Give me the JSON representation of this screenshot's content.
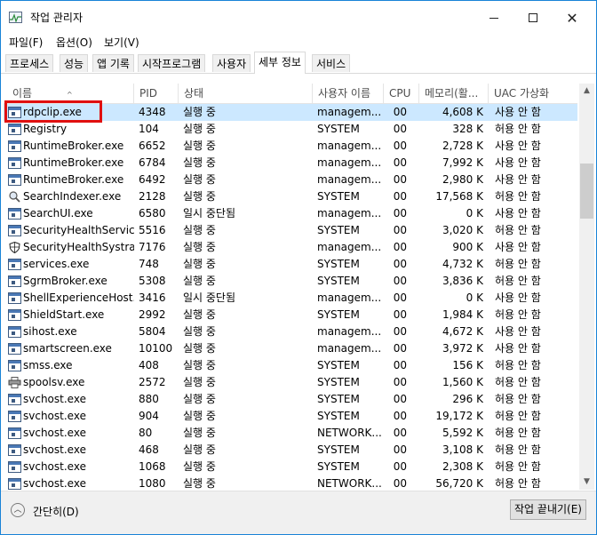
{
  "window": {
    "title": "작업 관리자"
  },
  "menu": [
    "파일(F)",
    "옵션(O)",
    "보기(V)"
  ],
  "tabs": [
    "프로세스",
    "성능",
    "앱 기록",
    "시작프로그램",
    "사용자",
    "세부 정보",
    "서비스"
  ],
  "active_tab": "세부 정보",
  "columns": {
    "name": "이름",
    "pid": "PID",
    "status": "상태",
    "user": "사용자 이름",
    "cpu": "CPU",
    "memory": "메모리(활...",
    "uac": "UAC 가상화"
  },
  "rows": [
    {
      "name": "rdpclip.exe",
      "pid": "4348",
      "status": "실행 중",
      "user": "managem...",
      "cpu": "00",
      "mem": "4,608 K",
      "uac": "사용 안 함",
      "icon": "exe-icon"
    },
    {
      "name": "Registry",
      "pid": "104",
      "status": "실행 중",
      "user": "SYSTEM",
      "cpu": "00",
      "mem": "328 K",
      "uac": "허용 안 함",
      "icon": "exe-icon"
    },
    {
      "name": "RuntimeBroker.exe",
      "pid": "6652",
      "status": "실행 중",
      "user": "managem...",
      "cpu": "00",
      "mem": "2,728 K",
      "uac": "사용 안 함",
      "icon": "exe-icon"
    },
    {
      "name": "RuntimeBroker.exe",
      "pid": "6784",
      "status": "실행 중",
      "user": "managem...",
      "cpu": "00",
      "mem": "7,992 K",
      "uac": "사용 안 함",
      "icon": "exe-icon"
    },
    {
      "name": "RuntimeBroker.exe",
      "pid": "6492",
      "status": "실행 중",
      "user": "managem...",
      "cpu": "00",
      "mem": "2,980 K",
      "uac": "사용 안 함",
      "icon": "exe-icon"
    },
    {
      "name": "SearchIndexer.exe",
      "pid": "2128",
      "status": "실행 중",
      "user": "SYSTEM",
      "cpu": "00",
      "mem": "17,568 K",
      "uac": "허용 안 함",
      "icon": "search-indexer-icon"
    },
    {
      "name": "SearchUI.exe",
      "pid": "6580",
      "status": "일시 중단됨",
      "user": "managem...",
      "cpu": "00",
      "mem": "0 K",
      "uac": "사용 안 함",
      "icon": "exe-icon"
    },
    {
      "name": "SecurityHealthServic...",
      "pid": "5516",
      "status": "실행 중",
      "user": "SYSTEM",
      "cpu": "00",
      "mem": "3,020 K",
      "uac": "허용 안 함",
      "icon": "exe-icon"
    },
    {
      "name": "SecurityHealthSystra...",
      "pid": "7176",
      "status": "실행 중",
      "user": "managem...",
      "cpu": "00",
      "mem": "900 K",
      "uac": "사용 안 함",
      "icon": "shield-icon"
    },
    {
      "name": "services.exe",
      "pid": "748",
      "status": "실행 중",
      "user": "SYSTEM",
      "cpu": "00",
      "mem": "4,732 K",
      "uac": "허용 안 함",
      "icon": "exe-icon"
    },
    {
      "name": "SgrmBroker.exe",
      "pid": "5308",
      "status": "실행 중",
      "user": "SYSTEM",
      "cpu": "00",
      "mem": "3,836 K",
      "uac": "허용 안 함",
      "icon": "exe-icon"
    },
    {
      "name": "ShellExperienceHost...",
      "pid": "3416",
      "status": "일시 중단됨",
      "user": "managem...",
      "cpu": "00",
      "mem": "0 K",
      "uac": "사용 안 함",
      "icon": "exe-icon"
    },
    {
      "name": "ShieldStart.exe",
      "pid": "2992",
      "status": "실행 중",
      "user": "SYSTEM",
      "cpu": "00",
      "mem": "1,984 K",
      "uac": "허용 안 함",
      "icon": "exe-icon"
    },
    {
      "name": "sihost.exe",
      "pid": "5804",
      "status": "실행 중",
      "user": "managem...",
      "cpu": "00",
      "mem": "4,672 K",
      "uac": "사용 안 함",
      "icon": "exe-icon"
    },
    {
      "name": "smartscreen.exe",
      "pid": "10100",
      "status": "실행 중",
      "user": "managem...",
      "cpu": "00",
      "mem": "3,972 K",
      "uac": "사용 안 함",
      "icon": "exe-icon"
    },
    {
      "name": "smss.exe",
      "pid": "408",
      "status": "실행 중",
      "user": "SYSTEM",
      "cpu": "00",
      "mem": "156 K",
      "uac": "허용 안 함",
      "icon": "exe-icon"
    },
    {
      "name": "spoolsv.exe",
      "pid": "2572",
      "status": "실행 중",
      "user": "SYSTEM",
      "cpu": "00",
      "mem": "1,560 K",
      "uac": "허용 안 함",
      "icon": "printer-icon"
    },
    {
      "name": "svchost.exe",
      "pid": "880",
      "status": "실행 중",
      "user": "SYSTEM",
      "cpu": "00",
      "mem": "296 K",
      "uac": "허용 안 함",
      "icon": "exe-icon"
    },
    {
      "name": "svchost.exe",
      "pid": "904",
      "status": "실행 중",
      "user": "SYSTEM",
      "cpu": "00",
      "mem": "19,172 K",
      "uac": "허용 안 함",
      "icon": "exe-icon"
    },
    {
      "name": "svchost.exe",
      "pid": "80",
      "status": "실행 중",
      "user": "NETWORK...",
      "cpu": "00",
      "mem": "5,592 K",
      "uac": "허용 안 함",
      "icon": "exe-icon"
    },
    {
      "name": "svchost.exe",
      "pid": "468",
      "status": "실행 중",
      "user": "SYSTEM",
      "cpu": "00",
      "mem": "3,108 K",
      "uac": "허용 안 함",
      "icon": "exe-icon"
    },
    {
      "name": "svchost.exe",
      "pid": "1068",
      "status": "실행 중",
      "user": "SYSTEM",
      "cpu": "00",
      "mem": "2,308 K",
      "uac": "허용 안 함",
      "icon": "exe-icon"
    },
    {
      "name": "svchost.exe",
      "pid": "1080",
      "status": "실행 중",
      "user": "NETWORK...",
      "cpu": "00",
      "mem": "56,720 K",
      "uac": "허용 안 함",
      "icon": "exe-icon"
    }
  ],
  "selected_row": 0,
  "footer": {
    "fewer_details": "간단히(D)",
    "end_task": "작업 끝내기(E)"
  },
  "colors": {
    "selection": "#cce8ff",
    "highlight_box": "#e01010",
    "window_border": "#1883d7"
  }
}
